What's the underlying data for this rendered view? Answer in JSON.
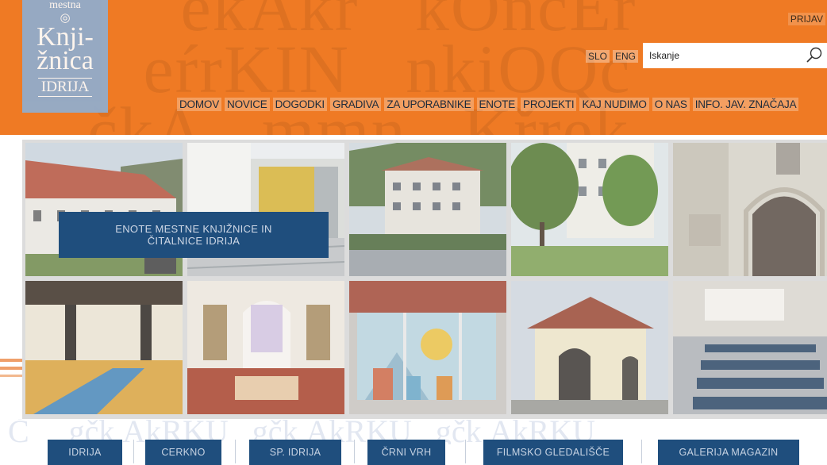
{
  "header": {
    "login_label": "PRIJAV",
    "logo": {
      "line1": "mestna",
      "line2": "Knji-",
      "line3": "žnica",
      "line4": "IDRIJA"
    },
    "languages": [
      "SLO",
      "ENG"
    ],
    "search": {
      "placeholder": "Iskanje",
      "icon": "search-icon"
    },
    "nav": [
      "DOMOV",
      "NOVICE",
      "DOGODKI",
      "GRADIVA",
      "ZA UPORABNIKE",
      "ENOTE",
      "PROJEKTI",
      "KAJ NUDIMO",
      "O NAS",
      "INFO. JAV. ZNAČAJA"
    ],
    "colors": {
      "accent": "#ef7a24",
      "logo_bg": "#8faed0"
    }
  },
  "gallery": {
    "overlay_title": "ENOTE MESTNE KNJIŽNICE IN ČITALNICE IDRIJA",
    "tiles": [
      "building-photo",
      "entrance-photo",
      "town-building-photo",
      "street-trees-photo",
      "arched-door-photo",
      "hall-interior-photo",
      "children-room-photo",
      "window-mural-photo",
      "chapel-gallery-photo",
      "cinema-hall-photo"
    ],
    "colors": {
      "overlay_bg": "#1f4e7d"
    }
  },
  "units": [
    "IDRIJA",
    "CERKNO",
    "SP. IDRIJA",
    "ČRNI VRH",
    "FILMSKO GLEDALIŠČE",
    "GALERIJA MAGAZIN"
  ]
}
